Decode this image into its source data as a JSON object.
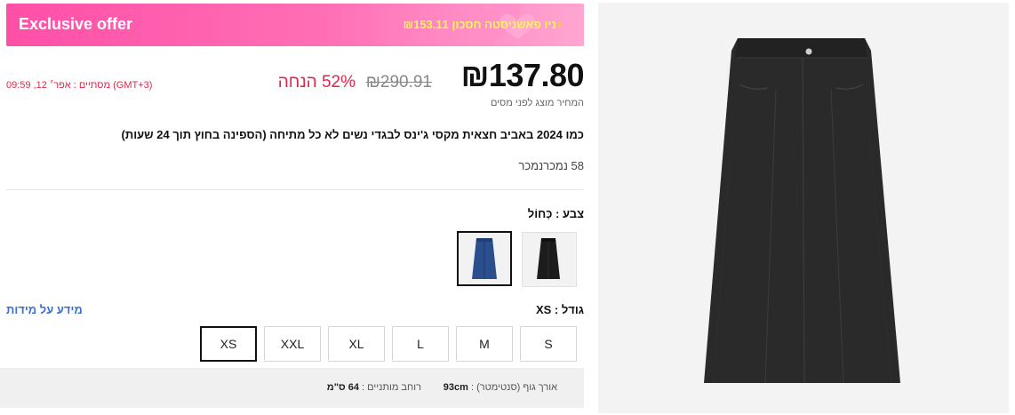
{
  "banner": {
    "title": "Exclusive offer",
    "promo_icon": "⚡",
    "promo_text": "ניו פאשניסטה חסכון ₪153.11"
  },
  "price": {
    "current": "₪137.80",
    "original": "₪290.91",
    "discount": "52% הנחה",
    "ends": "מסתיים : אפר׳ 12, 09:59 (GMT+3)",
    "note": "המחיר מוצג לפני מסים"
  },
  "product": {
    "title": "כמו 2024 באביב חצאית מקסי ג'ינס לבגדי נשים לא כל מתיחה (הספינה בחוץ תוך 24 שעות)",
    "sold": "58 נמכרנמכר"
  },
  "color": {
    "label": "צבע : כְּחוֹל",
    "swatches": [
      {
        "name": "blue",
        "selected": true
      },
      {
        "name": "black",
        "selected": false
      }
    ]
  },
  "size": {
    "label": "גודל : XS",
    "info_link": "מידע על מידות",
    "options": [
      "S",
      "M",
      "L",
      "XL",
      "XXL",
      "XS"
    ],
    "selected": "XS"
  },
  "measurements": {
    "length_label": "אורך גוף (סנטימטר) :",
    "length_value": "93cm",
    "waist_label": "רוחב מותניים :",
    "waist_value": "64 ס\"מ"
  },
  "colors": {
    "accent_pink": "#ff4fa7",
    "discount_red": "#e0264b",
    "link_blue": "#3a6fd8"
  }
}
